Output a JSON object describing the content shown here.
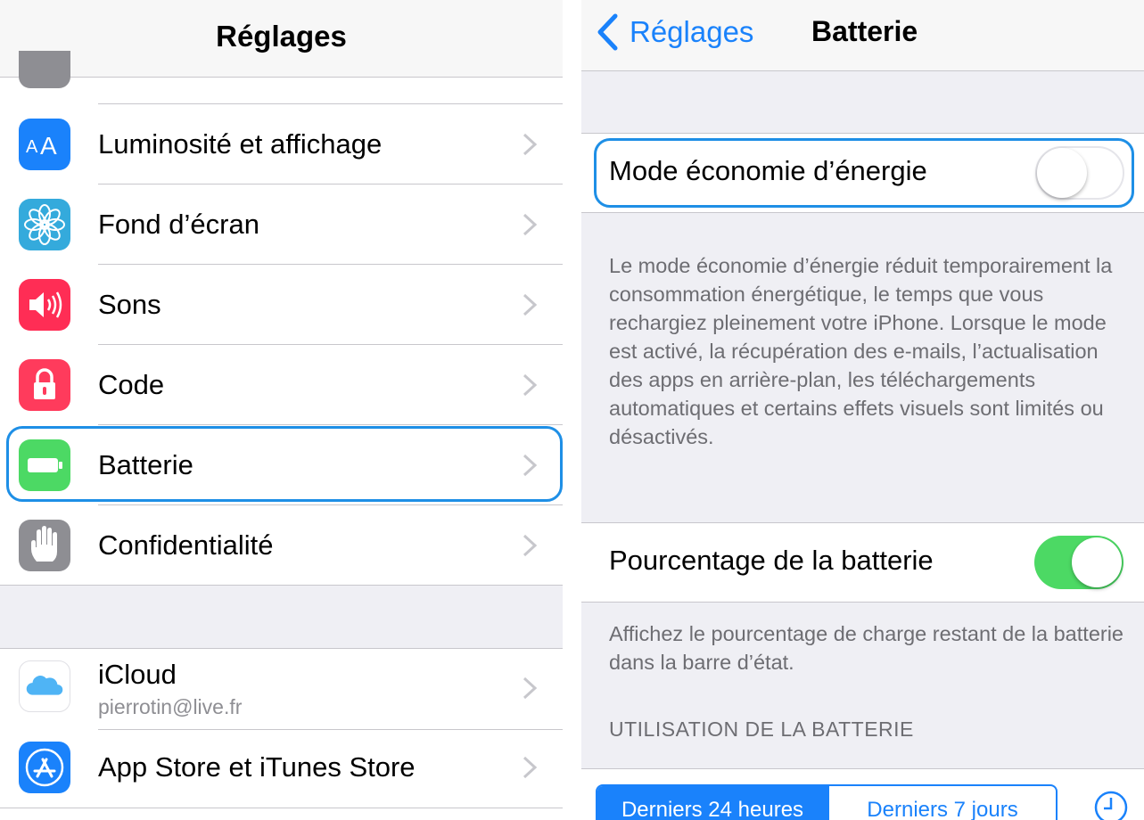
{
  "settings": {
    "title": "Réglages",
    "items": [
      {
        "label": "Luminosité et affichage",
        "icon": "brightness-aa-icon",
        "color": "#1a82fb"
      },
      {
        "label": "Fond d’écran",
        "icon": "wallpaper-flower-icon",
        "color": "#34aadc"
      },
      {
        "label": "Sons",
        "icon": "speaker-icon",
        "color": "#ff2d55"
      },
      {
        "label": "Code",
        "icon": "lock-icon",
        "color": "#ff3b5c"
      },
      {
        "label": "Batterie",
        "icon": "battery-icon",
        "color": "#4cd964"
      },
      {
        "label": "Confidentialité",
        "icon": "hand-icon",
        "color": "#8e8e93"
      }
    ],
    "accounts": [
      {
        "label": "iCloud",
        "subtitle": "pierrotin@live.fr",
        "icon": "icloud-icon"
      },
      {
        "label": "App Store et iTunes Store",
        "icon": "app-store-icon",
        "color": "#1a82fb"
      }
    ]
  },
  "battery": {
    "back_label": "Réglages",
    "title": "Batterie",
    "low_power": {
      "label": "Mode économie d’énergie",
      "on": false
    },
    "low_power_footer": "Le mode économie d’énergie réduit temporairement la consommation énergétique, le temps que vous rechargiez pleinement votre iPhone. Lorsque le mode est activé, la récupération des e-mails, l’actualisation des apps en arrière-plan, les téléchargements automatiques et certains effets visuels sont limités ou désactivés.",
    "percentage": {
      "label": "Pourcentage de la batterie",
      "on": true
    },
    "percentage_footer": "Affichez le pourcentage de charge restant de la batterie dans la barre d’état.",
    "usage_header": "UTILISATION DE LA BATTERIE",
    "segments": [
      "Derniers 24 heures",
      "Derniers 7 jours"
    ]
  },
  "colors": {
    "accent": "#1a82fb",
    "highlight": "#1e8fe6",
    "switch_on": "#4cd964"
  }
}
